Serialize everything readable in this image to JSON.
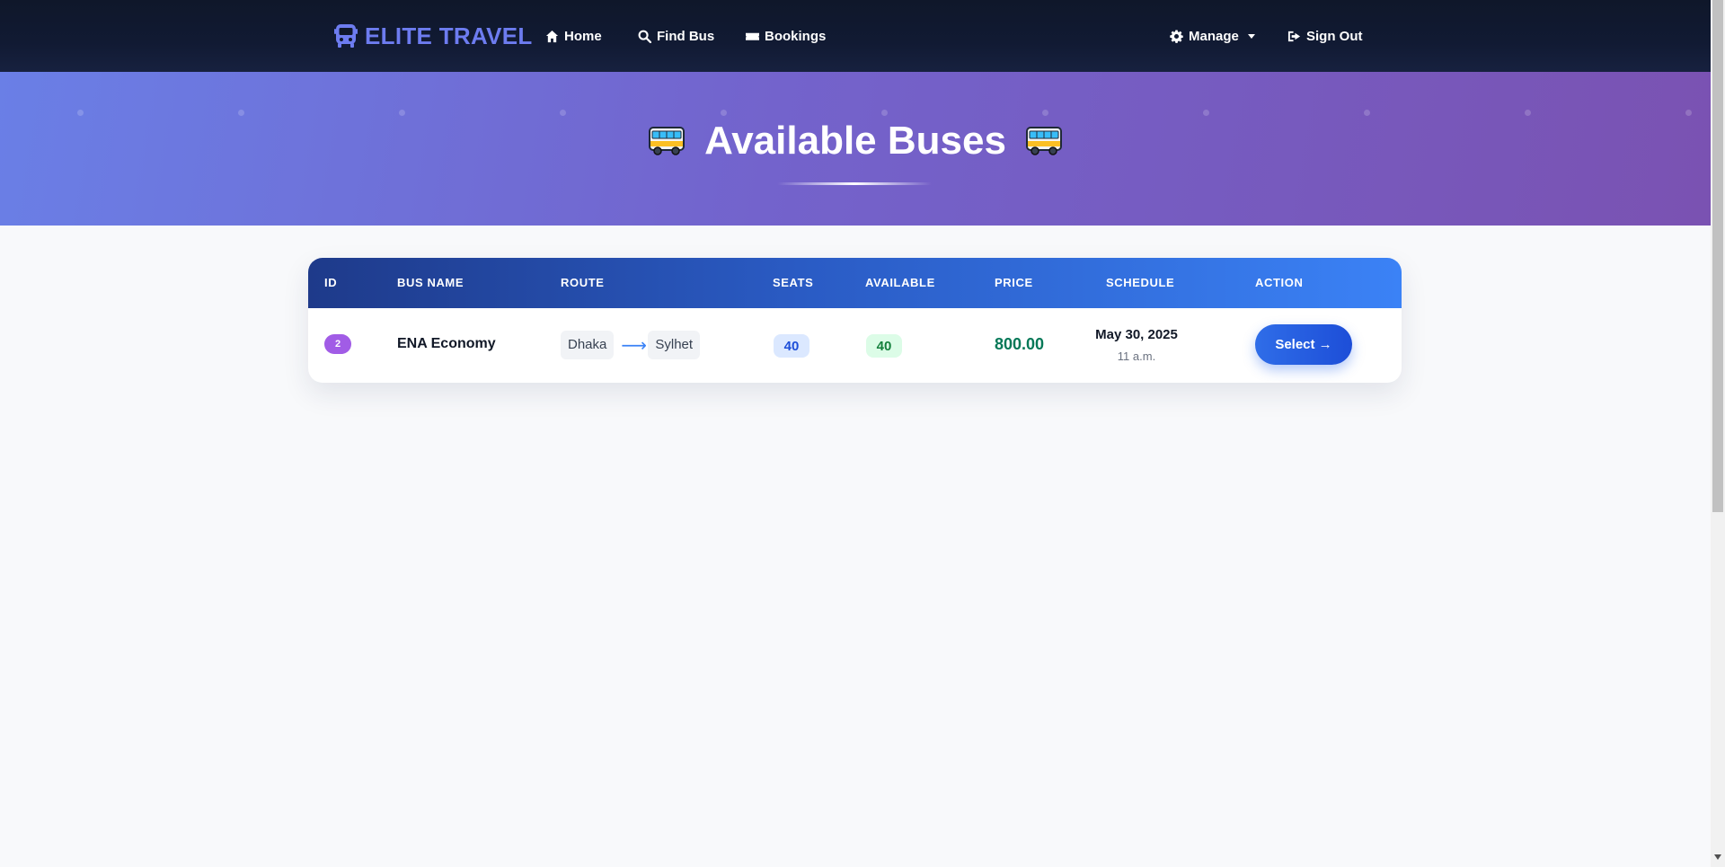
{
  "navbar": {
    "brand": "ELITE TRAVEL",
    "brand_icon": "bus-icon",
    "links": {
      "home": "Home",
      "find_bus": "Find Bus",
      "bookings": "Bookings",
      "manage": "Manage",
      "sign_out": "Sign Out"
    },
    "icons": {
      "home": "home-icon",
      "find_bus": "search-icon",
      "bookings": "ticket-icon",
      "manage": "gear-icon",
      "sign_out": "sign-out-icon"
    }
  },
  "hero": {
    "title": "Available Buses",
    "icon": "bus-emoji"
  },
  "table": {
    "columns": [
      "ID",
      "BUS NAME",
      "ROUTE",
      "SEATS",
      "AVAILABLE",
      "PRICE",
      "SCHEDULE",
      "ACTION"
    ],
    "rows": [
      {
        "id": "2",
        "bus_name": "ENA Economy",
        "route_from": "Dhaka",
        "route_arrow": "⟶",
        "route_to": "Sylhet",
        "seats": "40",
        "available": "40",
        "price": "800.00",
        "schedule_date": "May 30, 2025",
        "schedule_time": "11 a.m.",
        "action_label": "Select →"
      }
    ]
  },
  "colors": {
    "brand": "#6d7cf0",
    "navbar_bg": "#0f172a",
    "hero_start": "#6a7fe6",
    "hero_end": "#7a52b2",
    "table_header_start": "#1e3a8a",
    "table_header_end": "#3b82f6",
    "id_badge": "#a15ce6",
    "price": "#047857",
    "button": "#2563eb"
  }
}
